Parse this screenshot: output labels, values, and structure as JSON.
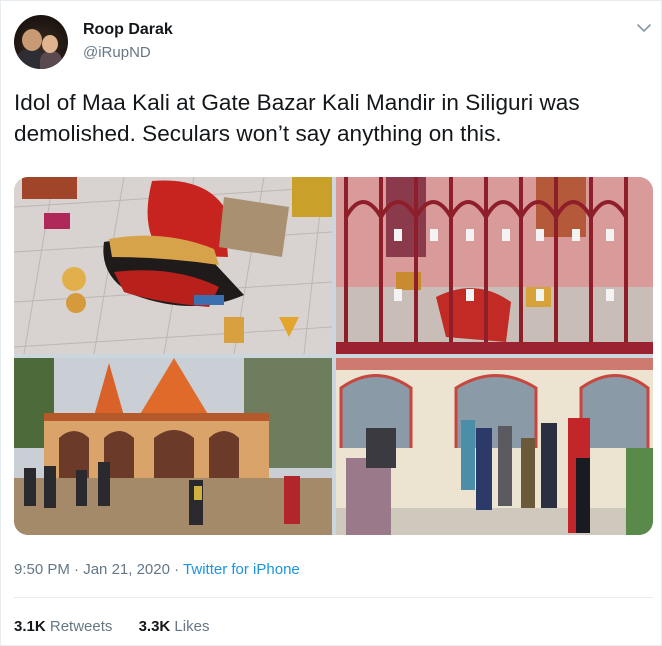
{
  "author": {
    "name": "Roop Darak",
    "handle": "@iRupND"
  },
  "tweet": {
    "text": "Idol of Maa Kali at Gate Bazar Kali Mandir in Siliguri was demolished. Seculars won’t say anything on this."
  },
  "media": {
    "count": 4,
    "icons": [
      "damaged-idol-photo",
      "temple-grille-photo",
      "temple-exterior-photo",
      "temple-crowd-photo"
    ]
  },
  "meta": {
    "time": "9:50 PM",
    "dot1": "·",
    "date": "Jan 21, 2020",
    "dot2": "·",
    "source": "Twitter for iPhone"
  },
  "stats": {
    "retweets_count": "3.1K",
    "retweets_label": "Retweets",
    "likes_count": "3.3K",
    "likes_label": "Likes"
  },
  "colors": {
    "text": "#14171a",
    "secondary": "#657786",
    "link": "#1b95e0",
    "divider": "#e6ecf0"
  }
}
